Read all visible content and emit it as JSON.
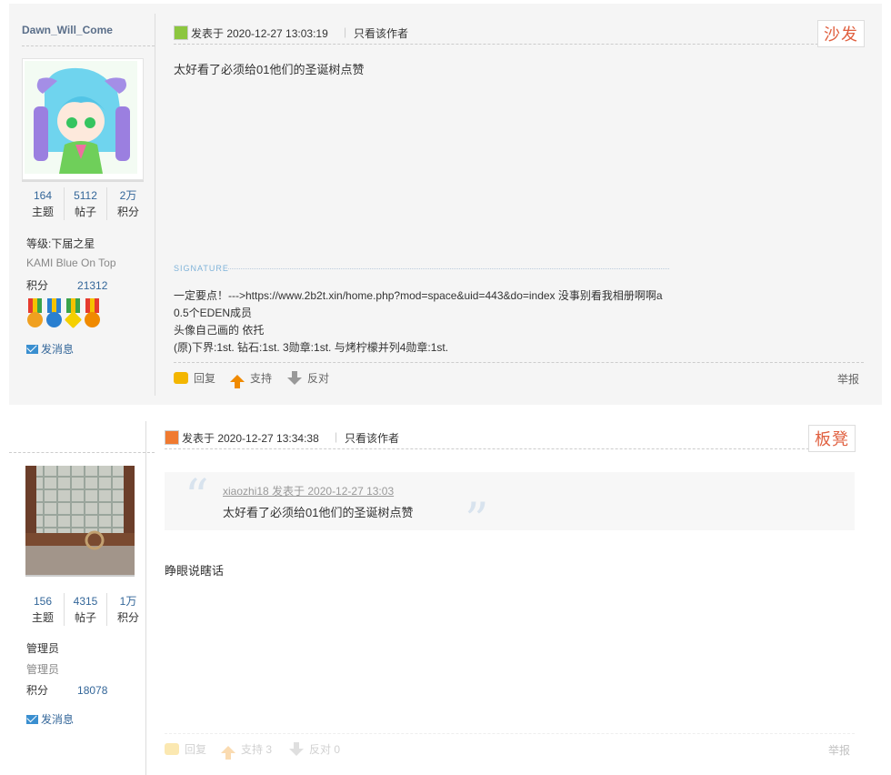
{
  "posts": [
    {
      "username": "Dawn_Will_Come",
      "stats": [
        {
          "num": "164",
          "label": "主题"
        },
        {
          "num": "5112",
          "label": "帖子"
        },
        {
          "num": "2万",
          "label": "积分"
        }
      ],
      "level": "等级:下届之星",
      "custom_title": "KAMI Blue On Top",
      "points_label": "积分",
      "points_value": "21312",
      "send_message": "发消息",
      "time": "发表于 2020-12-27 13:03:19",
      "sep": "|",
      "only_author": "只看该作者",
      "floor": "沙发",
      "body": "太好看了必须给01他们的圣诞树点赞",
      "signature_label": "SIGNATURE",
      "signature": [
        "一定要点！--->https://www.2b2t.xin/home.php?mod=space&uid=443&do=index 没事别看我相册啊啊a",
        "0.5个EDEN成员",
        "头像自己画的 依托",
        "(原)下界:1st. 钻石:1st. 3勋章:1st. 与烤柠檬并列4勋章:1st."
      ],
      "actions": {
        "reply": "回复",
        "support": "支持",
        "oppose": "反对",
        "report": "举报"
      }
    },
    {
      "stats": [
        {
          "num": "156",
          "label": "主题"
        },
        {
          "num": "4315",
          "label": "帖子"
        },
        {
          "num": "1万",
          "label": "积分"
        }
      ],
      "level": "管理员",
      "custom_title": "管理员",
      "points_label": "积分",
      "points_value": "18078",
      "send_message": "发消息",
      "time": "发表于 2020-12-27 13:34:38",
      "sep": "|",
      "only_author": "只看该作者",
      "floor": "板凳",
      "quote_source": "xiaozhi18 发表于 2020-12-27 13:03",
      "quote_text": "太好看了必须给01他们的圣诞树点赞",
      "body": "睁眼说瞎话",
      "actions": {
        "reply": "回复",
        "support": "支持 3",
        "oppose": "反对 0",
        "report": "举报"
      }
    }
  ],
  "colors": {
    "link": "#336699",
    "floor": "#e06040",
    "bg": "#f5f5f5"
  }
}
